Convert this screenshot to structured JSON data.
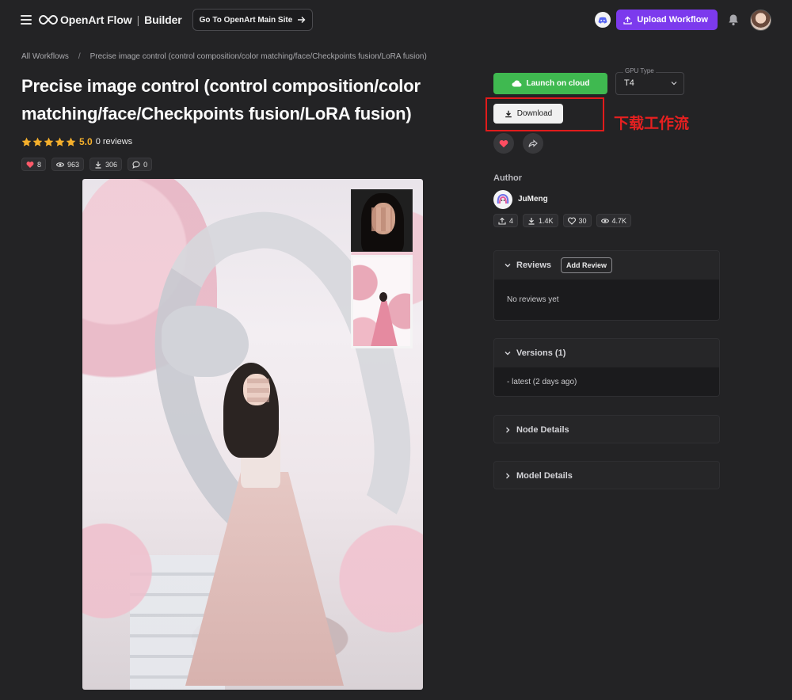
{
  "header": {
    "brand": "OpenArt Flow",
    "brand_sub": "Builder",
    "main_site_label": "Go To OpenArt Main Site",
    "upload_label": "Upload Workflow",
    "accent_color": "#7c3aed"
  },
  "breadcrumb": {
    "root": "All Workflows",
    "separator": "/",
    "current": "Precise image control (control composition/color matching/face/Checkpoints fusion/LoRA fusion)"
  },
  "workflow": {
    "title": "Precise image control (control composition/color matching/face/Checkpoints fusion/LoRA fusion)",
    "rating": "5.0",
    "reviews_count": "0 reviews",
    "stats": {
      "likes": "8",
      "views": "963",
      "downloads": "306",
      "comments": "0"
    }
  },
  "actions": {
    "launch_label": "Launch on cloud",
    "gpu_label": "GPU Type",
    "gpu_value": "T4",
    "download_label": "Download",
    "annotation": "下载工作流",
    "launch_color": "#3fb950",
    "annotation_color": "#e11b1b"
  },
  "author": {
    "section_label": "Author",
    "name": "JuMeng",
    "stats": {
      "uploads": "4",
      "downloads": "1.4K",
      "likes": "30",
      "views": "4.7K"
    }
  },
  "panels": {
    "reviews": {
      "title": "Reviews",
      "add_label": "Add Review",
      "empty": "No reviews yet"
    },
    "versions": {
      "title": "Versions (1)",
      "item": "- latest (2 days ago)"
    },
    "node_details": {
      "title": "Node Details"
    },
    "model_details": {
      "title": "Model Details"
    }
  },
  "icons": {
    "menu": "hamburger-icon",
    "logo": "infinity-logo-icon",
    "arrow": "arrow-right-icon",
    "discord": "discord-icon",
    "upload": "upload-icon",
    "bell": "bell-icon",
    "star": "star-icon",
    "heart": "heart-icon",
    "eye": "eye-icon",
    "download": "download-icon",
    "comment": "comment-icon",
    "cloud": "cloud-icon",
    "chevron": "chevron-down-icon",
    "share": "share-icon"
  }
}
